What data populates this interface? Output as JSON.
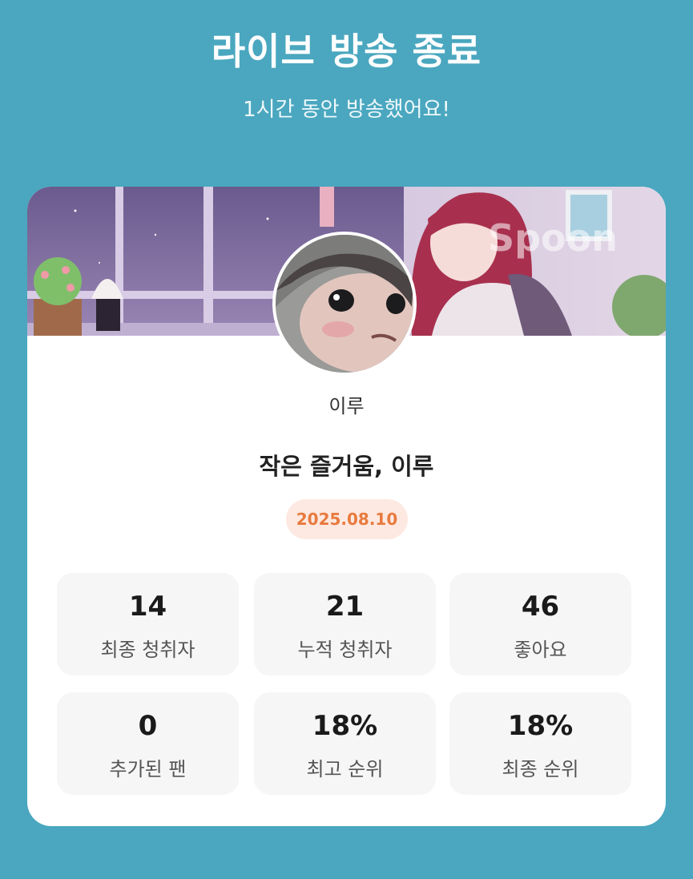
{
  "header": {
    "title": "라이브 방송 종료",
    "subtitle": "1시간 동안 방송했어요!"
  },
  "banner": {
    "watermark": "Spoon"
  },
  "profile": {
    "username": "이루"
  },
  "broadcast": {
    "title": "작은 즐거움, 이루",
    "date": "2025.08.10"
  },
  "stats": [
    {
      "value": "14",
      "label": "최종 청취자"
    },
    {
      "value": "21",
      "label": "누적 청취자"
    },
    {
      "value": "46",
      "label": "좋아요"
    },
    {
      "value": "0",
      "label": "추가된 팬"
    },
    {
      "value": "18%",
      "label": "최고 순위"
    },
    {
      "value": "18%",
      "label": "최종 순위"
    }
  ],
  "colors": {
    "background": "#4aa7bf",
    "card": "#ffffff",
    "badge_bg": "#fde9e1",
    "badge_text": "#e87a3e",
    "stat_bg": "#f6f6f6"
  }
}
